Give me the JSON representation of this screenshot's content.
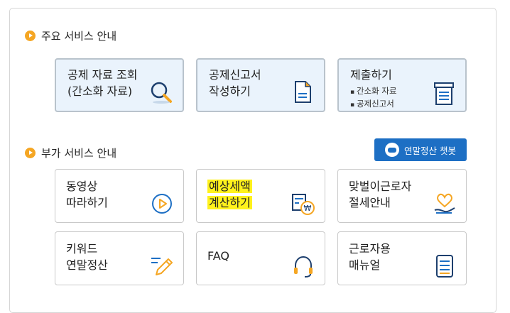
{
  "main_section": {
    "title": "주요 서비스 안내",
    "cards": [
      {
        "label": "공제 자료 조회\n(간소화 자료)",
        "icon": "magnifier-icon"
      },
      {
        "label": "공제신고서\n작성하기",
        "icon": "document-icon"
      },
      {
        "label": "제출하기",
        "sub": [
          "간소화 자료",
          "공제신고서"
        ],
        "icon": "fax-icon"
      }
    ]
  },
  "extra_section": {
    "title": "부가 서비스 안내",
    "chatbot_label": "연말정산 챗봇",
    "cards": [
      {
        "label": "동영상\n따라하기",
        "icon": "play-icon"
      },
      {
        "label_line1": "예상세액",
        "label_line2": "계산하기",
        "icon": "calculator-money-icon",
        "highlight": true
      },
      {
        "label": "맞벌이근로자\n절세안내",
        "icon": "heart-hand-icon"
      },
      {
        "label": "키워드\n연말정산",
        "icon": "pencil-icon"
      },
      {
        "label": "FAQ",
        "icon": "headset-icon"
      },
      {
        "label": "근로자용\n매뉴얼",
        "icon": "manual-icon"
      }
    ]
  },
  "colors": {
    "accent_orange": "#f5a623",
    "accent_blue": "#1d6fc4",
    "main_card_bg": "#eaf3fc"
  }
}
